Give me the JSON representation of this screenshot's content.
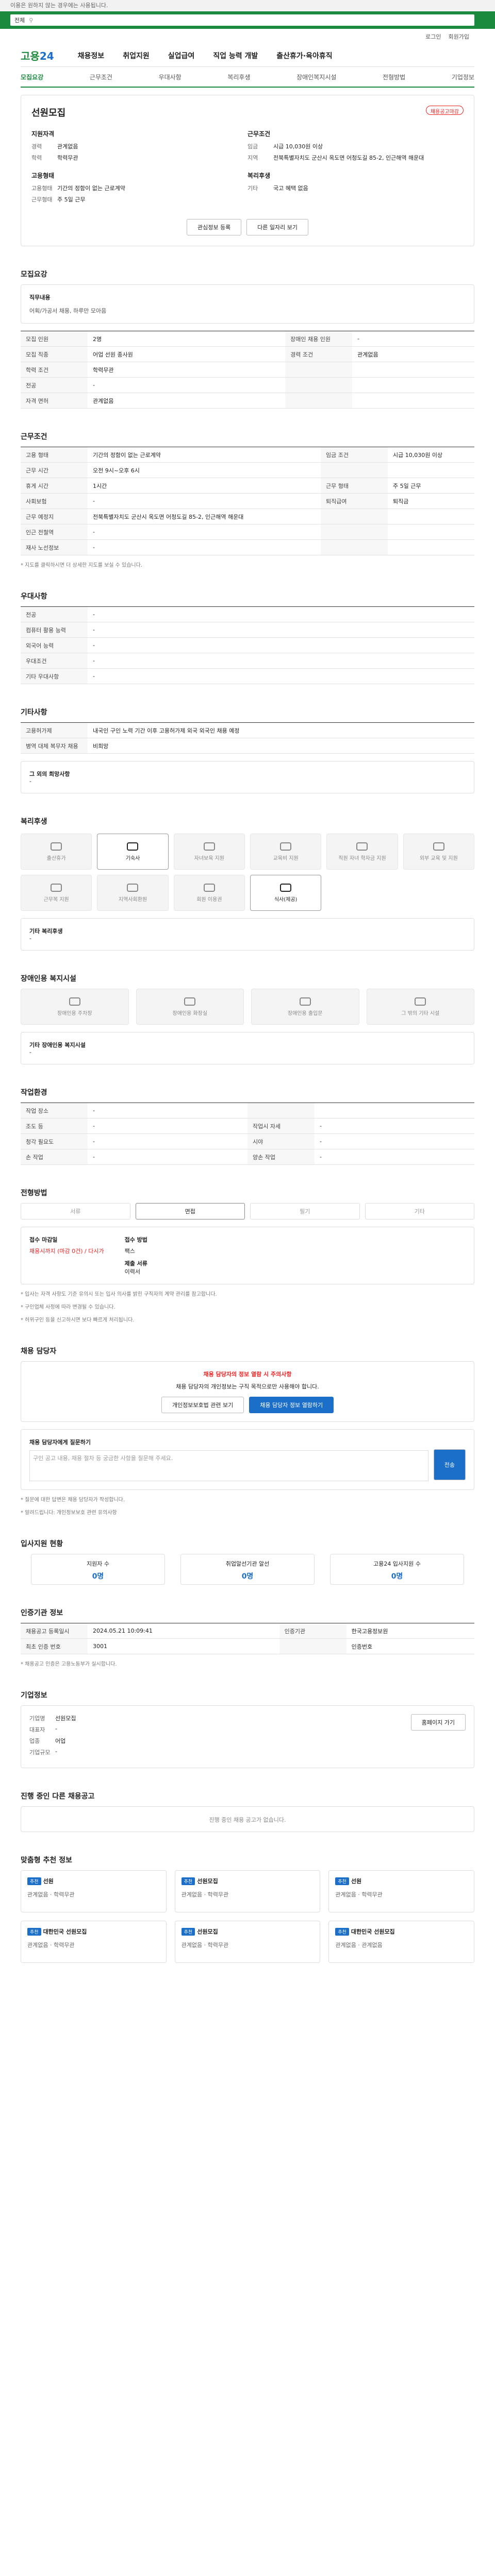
{
  "banner": "이용은 원하지 않는 경우에는 사용됩니다.",
  "search": {
    "select": "전체",
    "placeholder": ""
  },
  "util": [
    "로그인",
    "회원가입"
  ],
  "logo": {
    "a": "고용",
    "b": "24"
  },
  "gnb": [
    "채용정보",
    "취업지원",
    "실업급여",
    "직업 능력 개발",
    "출산휴가·육아휴직"
  ],
  "tabs": [
    "모집요강",
    "근무조건",
    "우대사항",
    "복리후생",
    "장애인복지시설",
    "전형방법",
    "기업정보"
  ],
  "company": {
    "name": "선원모집",
    "badge": "채용공고마감"
  },
  "recruit": {
    "title": "지원자격",
    "rows": [
      {
        "k": "경력",
        "v": "관계없음"
      },
      {
        "k": "학력",
        "v": "학력무관"
      }
    ]
  },
  "work": {
    "title": "근무조건",
    "rows": [
      {
        "k": "임금",
        "v": "시급 10,030원 이상"
      },
      {
        "k": "지역",
        "v": "전북특별자치도 군산시 옥도면 어청도길 85-2, 인근해역 해운대"
      }
    ]
  },
  "employ": {
    "title": "고용형태",
    "rows": [
      {
        "k": "고용형태",
        "v": "기간의 정함이 없는 근로계약"
      },
      {
        "k": "근무형태",
        "v": "주 5일 근무"
      }
    ]
  },
  "welfare_s": {
    "title": "복리후생",
    "rows": [
      {
        "k": "기타",
        "v": "국고 혜택 없음"
      }
    ]
  },
  "actions": [
    "관심정보 등록",
    "다른 일자리 보기"
  ],
  "s1": {
    "title": "모집요강",
    "head": "직무내용",
    "body": "어획/가공서 채용, 하루만 모아음",
    "rows": [
      [
        "모집 인원",
        "2명",
        "장애인 채용 인원",
        "-"
      ],
      [
        "모집 직종",
        "어업 선원 종사원",
        "경력 조건",
        "관계없음"
      ],
      [
        "학력 조건",
        "학력무관",
        "",
        ""
      ],
      [
        "전공",
        "-",
        "",
        ""
      ],
      [
        "자격 면허",
        "관계없음",
        "",
        ""
      ]
    ]
  },
  "s2": {
    "title": "근무조건",
    "rows": [
      [
        "고용 형태",
        "기간의 정함이 없는 근로계약",
        "임금 조건",
        "시급 10,030원 이상"
      ],
      [
        "근무 시간",
        "오전 9시~오후 6시",
        "",
        ""
      ],
      [
        "휴게 시간",
        "1시간",
        "근무 형태",
        "주 5일 근무"
      ],
      [
        "사회보험",
        "-",
        "퇴직급여",
        "퇴직금"
      ],
      [
        "근무 예정지",
        "전북특별자치도 군산시 옥도면 어청도길 85-2, 인근해역 해운대",
        "",
        ""
      ],
      [
        "인근 전철역",
        "-",
        "",
        ""
      ],
      [
        "재사 노선정보",
        "-",
        "",
        ""
      ]
    ],
    "note": "* 지도를 클릭하시면 더 상세한 지도를 보실 수 있습니다."
  },
  "s3": {
    "title": "우대사항",
    "rows": [
      [
        "전공",
        "-"
      ],
      [
        "컴퓨터 활용 능력",
        "-"
      ],
      [
        "외국어 능력",
        "-"
      ],
      [
        "우대조건",
        "-"
      ],
      [
        "기타 우대사항",
        "-"
      ]
    ]
  },
  "s4": {
    "title": "기타사항",
    "rows": [
      [
        "고용허가제",
        "내국인 구인 노력 기간 이후 고용허가제 외국 외국인 채용 예정"
      ],
      [
        "병역 대체 복무자 채용",
        "비희망"
      ]
    ],
    "extra_h": "그 외의 희망사항",
    "extra_v": "-"
  },
  "s5": {
    "title": "복리후생",
    "items": [
      "출산휴가",
      "기숙사",
      "자녀보육 지원",
      "교육비 지원",
      "직원 자녀 학자금 지원",
      "외부 교육 및 지원",
      "근무복 지원",
      "지역사회환원",
      "회원 이용권",
      "식사(제공)"
    ],
    "extra_h": "기타 복리후생",
    "extra_v": "-"
  },
  "s6": {
    "title": "장애인용 복지시설",
    "items": [
      "장애인용 주차장",
      "장애인용 화장실",
      "장애인용 출입문",
      "그 밖의 기타 시설"
    ],
    "extra_h": "기타 장애인용 복지시설",
    "extra_v": "-"
  },
  "s7": {
    "title": "작업환경",
    "rows": [
      [
        "작업 장소",
        "-",
        "",
        ""
      ],
      [
        "조도 등",
        "-",
        "작업시 자세",
        "-"
      ],
      [
        "청각 필요도",
        "-",
        "시야",
        "-"
      ],
      [
        "손 작업",
        "-",
        "양손 작업",
        "-"
      ]
    ]
  },
  "s8": {
    "title": "전형방법",
    "steps": [
      "서류",
      "면접",
      "필기",
      "기타"
    ],
    "l1": "접수 마감일",
    "v1": "채용시까지 (마감 0건) / 다시가",
    "l2": "접수 방법",
    "v2": "팩스",
    "l3": "제출 서류",
    "v3": "이력서",
    "notes": [
      "* 입사는 자격 사항도 기준 유의시 또는 입사 의사를 밝힌 구직자의 계약 관리를 참고합니다.",
      "* 구인업체 사정에 따라 변경될 수 있습니다.",
      "* 허위구인 등을 신고하시면 보다 빠르게 처리됩니다."
    ]
  },
  "s9": {
    "title": "채용 담당자",
    "alert_h": "채용 담당자의 정보 열람 시 주의사항",
    "alert_b": "채용 담당자의 개인정보는 구직 목적으로만 사용해야 합니다.",
    "b1": "개인정보보호법 관련 보기",
    "b2": "채용 담당자 정보 열람하기",
    "q_h": "채용 담당자에게 질문하기",
    "q_b": "구인 공고 내용, 채용 절차 등 궁금한 사항을 질문해 주세요.",
    "q_btn": "전송",
    "q_notes": [
      "* 질문에 대한 답변은 채용 담당자가 작성합니다.",
      "* 알려드립니다: 개인정보보호 관련 유의사항"
    ]
  },
  "s10": {
    "title": "입사지원 현황",
    "stats": [
      {
        "k": "지원자 수",
        "v": "0명"
      },
      {
        "k": "취업알선기관 알선",
        "v": "0명"
      },
      {
        "k": "고용24 입사지원 수",
        "v": "0명"
      }
    ]
  },
  "s11": {
    "title": "인증기관 정보",
    "rows": [
      [
        "채용공고 등록일시",
        "2024.05.21 10:09:41",
        "인증기관",
        "한국고용정보원"
      ],
      [
        "최초 인증 번호",
        "3001",
        "",
        "인증번호"
      ]
    ],
    "note": "* 채용공고 인증은 고용노동부가 실시합니다."
  },
  "s12": {
    "title": "기업정보",
    "rows": [
      [
        "기업명",
        "선원모집"
      ],
      [
        "대표자",
        "-"
      ],
      [
        "업종",
        "어업"
      ],
      [
        "기업규모",
        "-"
      ]
    ],
    "btn": "홈페이지 가기"
  },
  "s13": {
    "title": "진행 중인 다른 채용공고",
    "empty": "진행 중인 채용 공고가 없습니다."
  },
  "s14": {
    "title": "맞춤형 추천 정보",
    "cards": [
      {
        "tag": "추천",
        "t": "선원",
        "a": "관계없음",
        "b": "학력무관"
      },
      {
        "tag": "추천",
        "t": "선원모집",
        "a": "관계없음",
        "b": "학력무관"
      },
      {
        "tag": "추천",
        "t": "선원",
        "a": "관계없음",
        "b": "학력무관"
      },
      {
        "tag": "추천",
        "t": "대한민국 선원모집",
        "a": "관계없음",
        "b": "학력무관"
      },
      {
        "tag": "추천",
        "t": "선원모집",
        "a": "관계없음",
        "b": "학력무관"
      },
      {
        "tag": "추천",
        "t": "대한민국 선원모집",
        "a": "관계없음",
        "b": "관계없음"
      }
    ]
  }
}
